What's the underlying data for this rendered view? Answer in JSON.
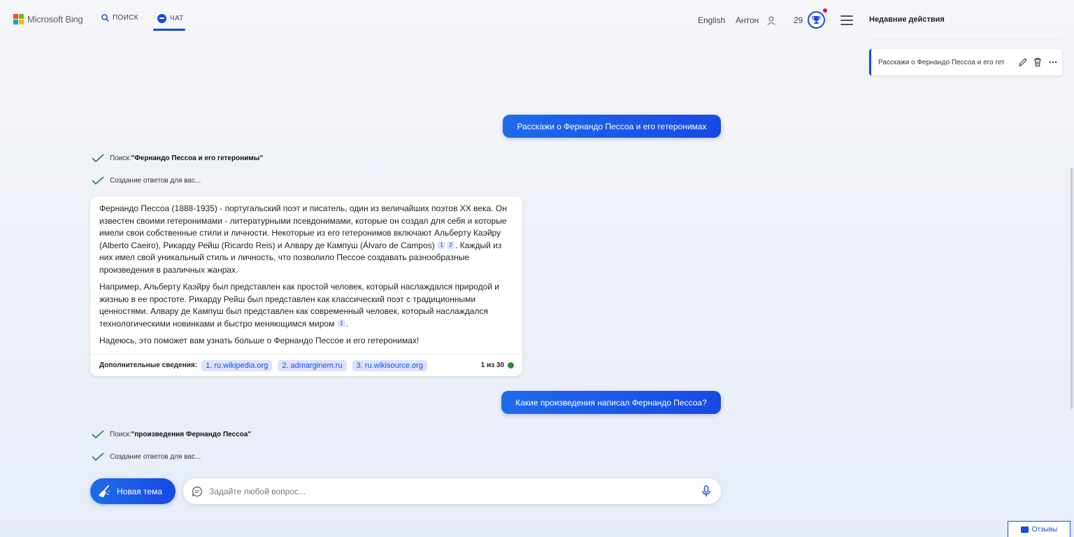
{
  "header": {
    "brand": "Microsoft Bing",
    "tabs": [
      {
        "label": "ПОИСК",
        "icon": "search-icon"
      },
      {
        "label": "ЧАТ",
        "icon": "chat-icon",
        "active": true
      }
    ],
    "language": "English",
    "user_name": "Антон",
    "points": "29",
    "recent_title": "Недавние действия"
  },
  "recent": {
    "items": [
      {
        "label": "Расскажи о Фернандо Пессоа и его гетеронимах"
      }
    ]
  },
  "conversation": {
    "q1": "Расскажи о Фернандо Пессоа и его гетеронимах",
    "status1": {
      "search_prefix": "Поиск: ",
      "search_query": "\"Фернандо Пессоа и его гетеронимы\"",
      "generating": "Создание ответов для вас..."
    },
    "answer": {
      "p1_a": "Фернандо Пессоа (1888-1935) - португальский поэт и писатель, один из величайших поэтов XX века. Он известен своими гетеронимами - литературными псевдонимами, которые он создал для себя и которые имели свои собственные стили и личности. Некоторые из его гетеронимов включают Альберту Каэйру (Alberto Caeiro), Рикарду Рейш (Ricardo Reis) и Алвару де Кампуш (Álvaro de Campos)",
      "p1_b": ". Каждый из них имел свой уникальный стиль и личность, что позволило Пессое создавать разнообразные произведения в различных жанрах.",
      "p2": "Например, Альберту Каэйру был представлен как простой человек, который наслаждался природой и жизнью в ее простоте. Рикарду Рейш был представлен как классический поэт с традиционными ценностями. Алвару де Кампуш был представлен как современный человек, который наслаждался технологическими новинками и быстро меняющимся миром",
      "p2_end": ".",
      "p3": "Надеюсь, это поможет вам узнать больше о Фернандо Пессое и его гетеронимах!",
      "cite1": "1",
      "cite2": "2",
      "cite3": "1",
      "footer_label": "Дополнительные сведения:",
      "sources": [
        "1. ru.wikipedia.org",
        "2. admarginem.ru",
        "3. ru.wikisource.org"
      ],
      "counter": "1 из 30",
      "counter_color": "#2f8a3b"
    },
    "q2": "Какие произведения написал Фернандо Пессоа?",
    "status2": {
      "search_prefix": "Поиск: ",
      "search_query": "\"произведения Фернандо Пессоа\"",
      "generating": "Создание ответов для вас..."
    }
  },
  "composer": {
    "new_topic": "Новая тема",
    "placeholder": "Задайте любой вопрос..."
  },
  "feedback": "Отзывы",
  "colors": {
    "accent": "#174ae4",
    "notification": "#e81123"
  }
}
